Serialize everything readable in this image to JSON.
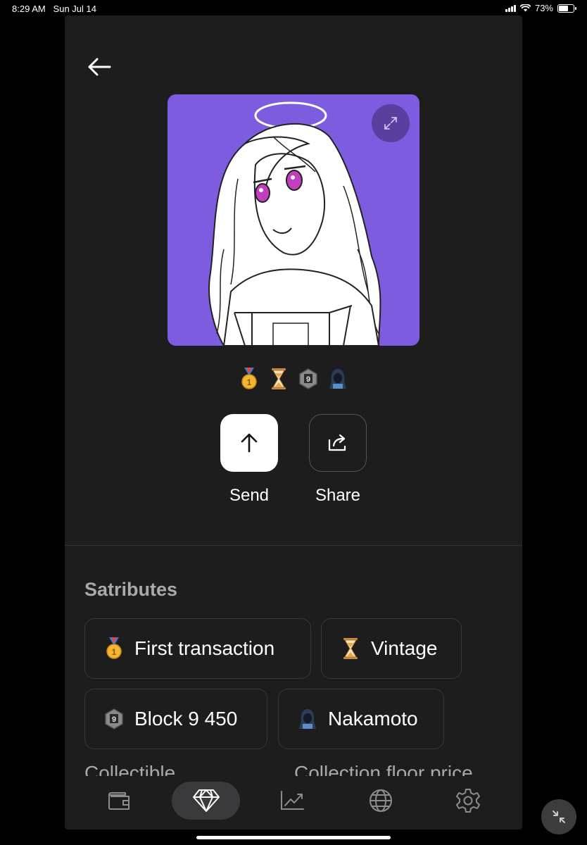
{
  "status_bar": {
    "time": "8:29 AM",
    "date": "Sun Jul 14",
    "battery": "73%",
    "battery_level": 0.73
  },
  "header": {
    "back_icon": "arrow-left-icon"
  },
  "artwork": {
    "background": "#7d5cdf",
    "expand_icon": "expand-icon"
  },
  "satribute_icons": [
    {
      "icon": "first-place-medal-icon"
    },
    {
      "icon": "hourglass-icon"
    },
    {
      "icon": "block-9-hexagon-icon"
    },
    {
      "icon": "hooded-figure-icon"
    }
  ],
  "actions": {
    "send_label": "Send",
    "share_label": "Share"
  },
  "satributes": {
    "title": "Satributes",
    "chips": [
      {
        "label": "First transaction",
        "icon": "first-place-medal-icon"
      },
      {
        "label": "Vintage",
        "icon": "hourglass-icon"
      },
      {
        "label": "Block 9 450",
        "icon": "block-9-hexagon-icon"
      },
      {
        "label": "Nakamoto",
        "icon": "hooded-figure-icon"
      }
    ]
  },
  "peek": {
    "left": "Collectible",
    "right": "Collection floor price"
  },
  "tab_bar": {
    "tabs": [
      {
        "icon": "wallet-icon",
        "active": false
      },
      {
        "icon": "diamond-icon",
        "active": true
      },
      {
        "icon": "chart-icon",
        "active": false
      },
      {
        "icon": "globe-icon",
        "active": false
      },
      {
        "icon": "gear-icon",
        "active": false
      }
    ]
  },
  "floating_button": {
    "icon": "collapse-icon"
  },
  "colors": {
    "panel": "#1d1d1e",
    "accent_purple": "#7d5cdf",
    "text_muted": "#a9a9ab"
  }
}
